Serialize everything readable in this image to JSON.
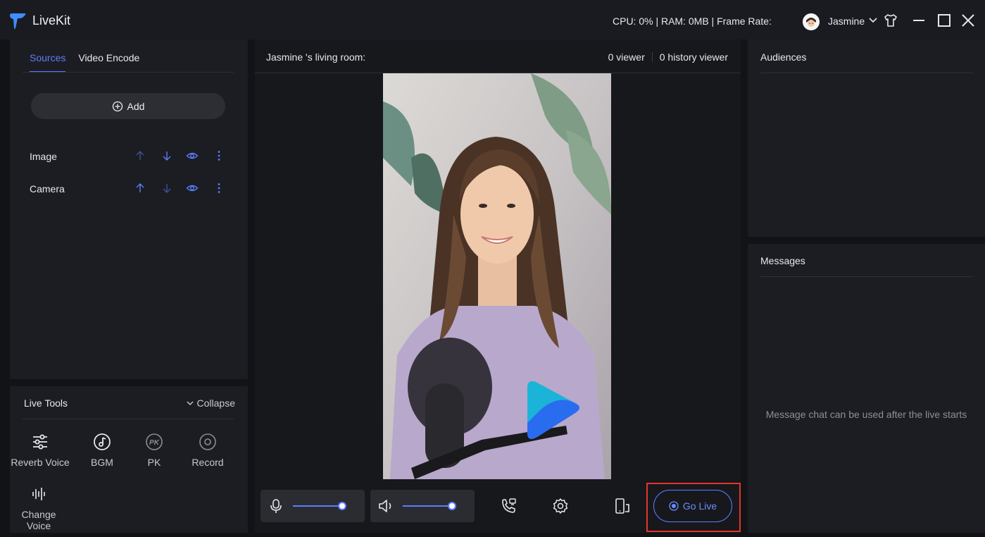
{
  "app": {
    "title": "LiveKit"
  },
  "header": {
    "stats": "CPU: 0% | RAM: 0MB | Frame Rate:",
    "user_name": "Jasmine"
  },
  "sources_panel": {
    "tabs": [
      {
        "label": "Sources",
        "active": true
      },
      {
        "label": "Video Encode",
        "active": false
      }
    ],
    "add_label": "Add",
    "items": [
      {
        "label": "Image"
      },
      {
        "label": "Camera"
      }
    ]
  },
  "live_tools": {
    "title": "Live Tools",
    "collapse_label": "Collapse",
    "tools": [
      {
        "label": "Reverb Voice",
        "icon": "reverb-icon"
      },
      {
        "label": "BGM",
        "icon": "music-note-icon"
      },
      {
        "label": "PK",
        "icon": "pk-icon"
      },
      {
        "label": "Record",
        "icon": "record-icon"
      },
      {
        "label": "Change Voice",
        "icon": "waveform-icon"
      }
    ]
  },
  "room": {
    "title": "Jasmine 's living room:",
    "viewers": "0 viewer",
    "history_viewers": "0 history viewer"
  },
  "controls": {
    "mic_level": 1.0,
    "speaker_level": 1.0,
    "go_live_label": "Go Live"
  },
  "audiences": {
    "title": "Audiences"
  },
  "messages": {
    "title": "Messages",
    "empty_text": "Message chat can be used after the live starts"
  },
  "colors": {
    "accent": "#5b7cff",
    "highlight_frame": "#e3342c",
    "background": "#121317",
    "panel": "#1c1d22"
  }
}
